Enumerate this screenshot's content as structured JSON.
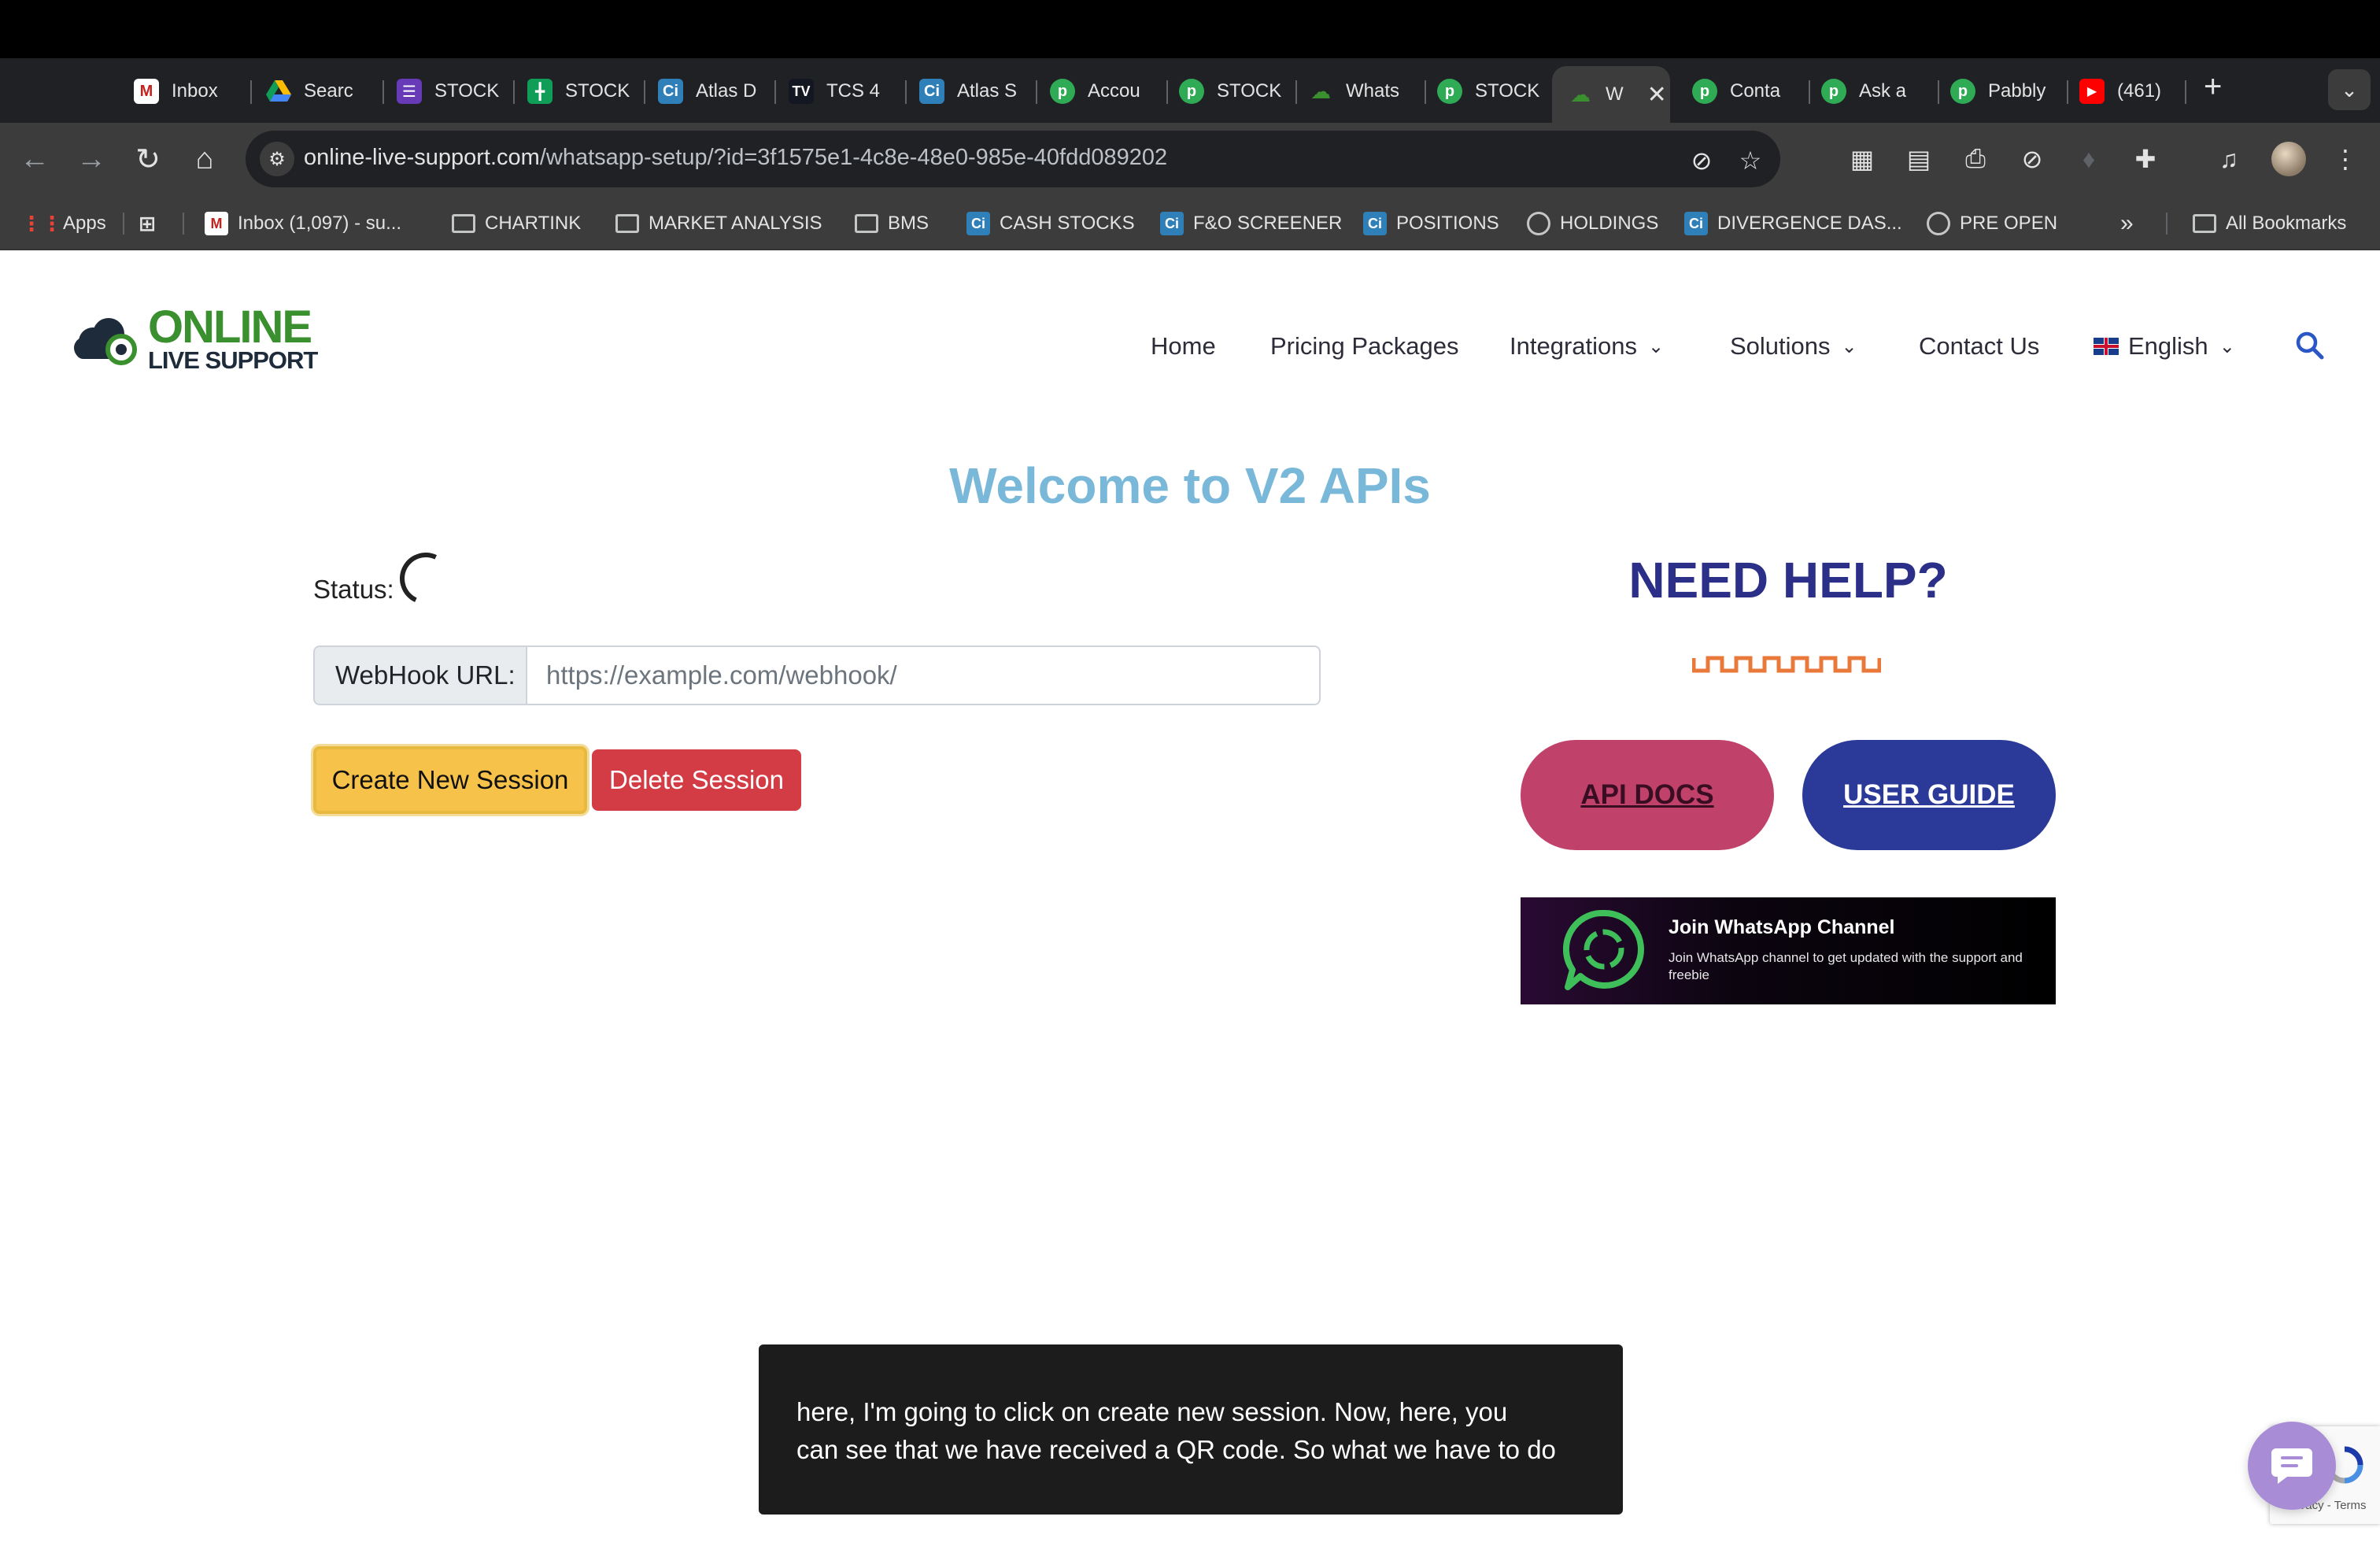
{
  "browser": {
    "tabs": [
      {
        "label": "Inbox",
        "icon": "gmail-icon",
        "color": "#c5221f"
      },
      {
        "label": "Searc",
        "icon": "drive-icon",
        "color": "#fbbc04"
      },
      {
        "label": "STOCK",
        "icon": "forms-icon",
        "color": "#673ab7"
      },
      {
        "label": "STOCK",
        "icon": "sheets-icon",
        "color": "#0f9d58"
      },
      {
        "label": "Atlas D",
        "icon": "ci-icon",
        "color": "#2f7fb8"
      },
      {
        "label": "TCS 4",
        "icon": "tradingview-icon",
        "color": "#131722"
      },
      {
        "label": "Atlas S",
        "icon": "ci-icon",
        "color": "#2f7fb8"
      },
      {
        "label": "Accou",
        "icon": "pabbly-icon",
        "color": "#2faa55"
      },
      {
        "label": "STOCK",
        "icon": "pabbly-icon",
        "color": "#2faa55"
      },
      {
        "label": "Whats",
        "icon": "cloud-icon",
        "color": "#3a8f2e"
      },
      {
        "label": "STOCK",
        "icon": "pabbly-icon",
        "color": "#2faa55"
      },
      {
        "label": "W",
        "icon": "cloud-icon",
        "color": "#3a8f2e",
        "active": true
      },
      {
        "label": "Conta",
        "icon": "pabbly-icon",
        "color": "#2faa55"
      },
      {
        "label": "Ask a",
        "icon": "pabbly-icon",
        "color": "#2faa55"
      },
      {
        "label": "Pabbly",
        "icon": "pabbly-icon",
        "color": "#2faa55"
      },
      {
        "label": "(461)",
        "icon": "youtube-icon",
        "color": "#ff0000"
      }
    ],
    "url_host": "online-live-support.com",
    "url_path": "/whatsapp-setup/?id=3f1575e1-4c8e-48e0-985e-40fdd089202",
    "bookmarks": [
      {
        "label": "Apps",
        "icon": "apps-grid-icon"
      },
      {
        "label": "",
        "icon": "tab-groups-icon"
      },
      {
        "label": "Inbox (1,097) - su...",
        "icon": "gmail-icon"
      },
      {
        "label": "CHARTINK",
        "icon": "folder-icon"
      },
      {
        "label": "MARKET ANALYSIS",
        "icon": "folder-icon"
      },
      {
        "label": "BMS",
        "icon": "folder-icon"
      },
      {
        "label": "CASH STOCKS",
        "icon": "ci-icon"
      },
      {
        "label": "F&O SCREENER",
        "icon": "ci-icon"
      },
      {
        "label": "POSITIONS",
        "icon": "ci-icon"
      },
      {
        "label": "HOLDINGS",
        "icon": "globe-icon"
      },
      {
        "label": "DIVERGENCE DAS...",
        "icon": "ci-icon"
      },
      {
        "label": "PRE OPEN",
        "icon": "globe-icon"
      }
    ],
    "bookmarks_overflow": "»",
    "all_bookmarks": "All Bookmarks"
  },
  "site": {
    "logo_line1": "ONLINE",
    "logo_line2": "LIVE SUPPORT",
    "nav": {
      "home": "Home",
      "pricing": "Pricing Packages",
      "integrations": "Integrations",
      "solutions": "Solutions",
      "contact": "Contact Us",
      "language": "English"
    }
  },
  "main": {
    "welcome": "Welcome to V2 APIs",
    "status_label": "Status:",
    "webhook_label": "WebHook URL:",
    "webhook_placeholder": "https://example.com/webhook/",
    "webhook_value": "",
    "create_button": "Create New Session",
    "delete_button": "Delete Session"
  },
  "help": {
    "title": "NEED HELP?",
    "api_docs": "API DOCS",
    "user_guide": "USER GUIDE",
    "banner_title": "Join WhatsApp Channel",
    "banner_subtitle": "Join WhatsApp channel to get updated with the support and freebie"
  },
  "caption": {
    "line1": "here, I'm going to click on create new session. Now, here, you",
    "line2": "can see that we have received a QR code. So what we have to do"
  },
  "recaptcha": {
    "privacy": "Privacy",
    "separator": " - ",
    "terms": "Terms"
  },
  "colors": {
    "welcome": "#7ab8d9",
    "need_help": "#2b2f87",
    "create": "#f6c24a",
    "delete": "#d33c44",
    "api_docs": "#c0416a",
    "user_guide": "#2b3a98",
    "brand_green": "#3a8f2e"
  }
}
